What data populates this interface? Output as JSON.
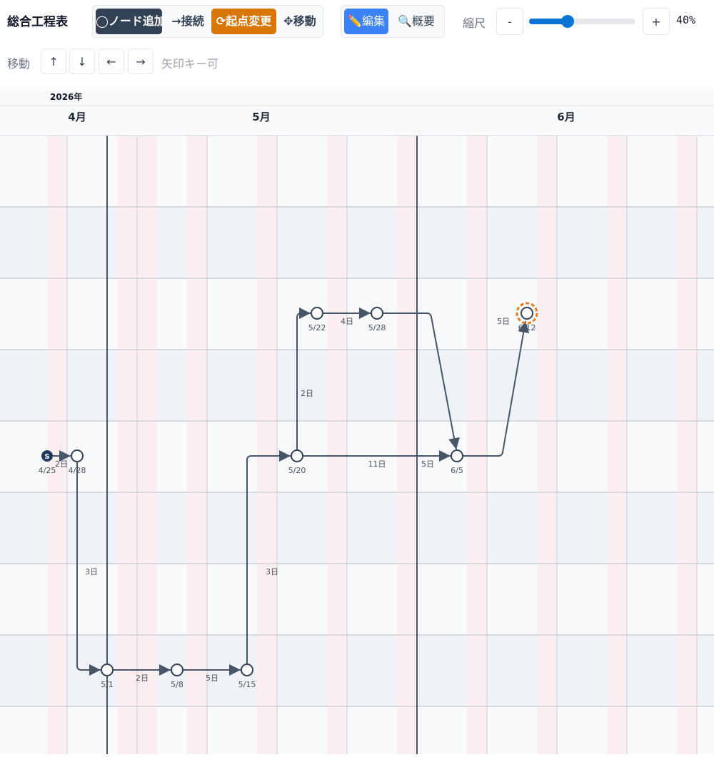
{
  "toolbar": {
    "title": "総合工程表",
    "add_node": "◯ノード追加",
    "connect": "→接続",
    "change_start": "⟳起点変更",
    "move": "✥移動",
    "edit": "✏️編集",
    "overview": "🔍概要",
    "scale_label": "縮尺",
    "zoom_out": "-",
    "zoom_in": "+",
    "zoom_value": "40%",
    "zoom_fraction": 0.4,
    "move_label": "移動",
    "up": "↑",
    "down": "↓",
    "left": "←",
    "right": "→",
    "arrow_hint": "矢印キー可"
  },
  "timeline": {
    "year": "2026年",
    "months": [
      "4月",
      "5月",
      "6月"
    ]
  },
  "nodes": [
    {
      "id": "S",
      "date": "4/25",
      "start": true,
      "badge": "S"
    },
    {
      "id": "n428",
      "date": "4/28"
    },
    {
      "id": "n501",
      "date": "5/1"
    },
    {
      "id": "n508",
      "date": "5/8"
    },
    {
      "id": "n515",
      "date": "5/15"
    },
    {
      "id": "n520",
      "date": "5/20"
    },
    {
      "id": "n522",
      "date": "5/22"
    },
    {
      "id": "n528",
      "date": "5/28"
    },
    {
      "id": "n605",
      "date": "6/5"
    },
    {
      "id": "n612",
      "date": "6/12",
      "selected": true
    }
  ],
  "edges": [
    {
      "from": "S",
      "to": "n428",
      "label": "2日"
    },
    {
      "from": "n428",
      "to": "n501",
      "label": "3日"
    },
    {
      "from": "n501",
      "to": "n508",
      "label": "2日"
    },
    {
      "from": "n508",
      "to": "n515",
      "label": "5日"
    },
    {
      "from": "n515",
      "to": "n520",
      "label": "3日"
    },
    {
      "from": "n520",
      "to": "n522",
      "label": "2日"
    },
    {
      "from": "n522",
      "to": "n528",
      "label": "4日"
    },
    {
      "from": "n520",
      "to": "n605",
      "label": "11日"
    },
    {
      "from": "n528",
      "to": "n605",
      "label": "5日"
    },
    {
      "from": "n605",
      "to": "n612",
      "label": "5日"
    }
  ],
  "colors": {
    "accent": "#3b82f6",
    "start_button": "#d97706",
    "dark": "#334155",
    "node_stroke": "#334155",
    "selected_ring": "#e67e22",
    "weekend_band": "#fbeef0"
  }
}
